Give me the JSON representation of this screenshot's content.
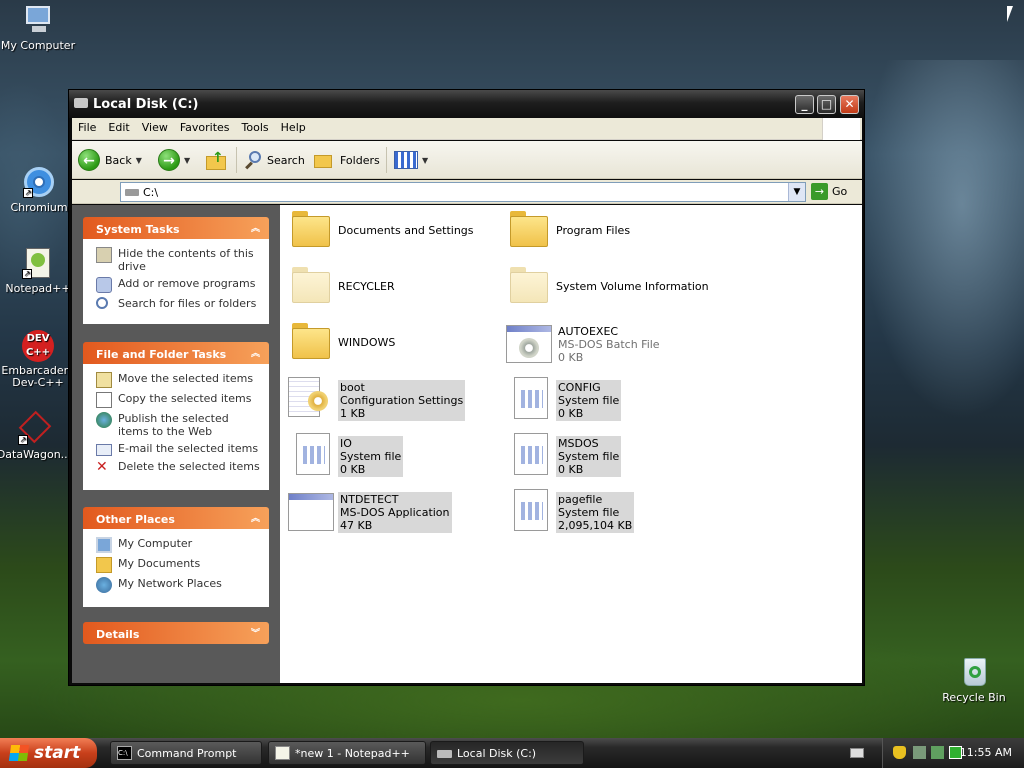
{
  "desktop": {
    "icons": [
      {
        "label": "My Computer"
      },
      {
        "label": "Chromium"
      },
      {
        "label": "Notepad++"
      },
      {
        "label": "Embarcadero Dev-C++"
      },
      {
        "label": "DataWagon..."
      },
      {
        "label": "Recycle Bin"
      }
    ]
  },
  "window": {
    "title": "Local Disk (C:)",
    "controls": {
      "minimize": "_",
      "maximize": "□",
      "close": "✕"
    }
  },
  "menu": [
    "File",
    "Edit",
    "View",
    "Favorites",
    "Tools",
    "Help"
  ],
  "toolbar": {
    "back_label": "Back",
    "search_label": "Search",
    "folders_label": "Folders"
  },
  "address": {
    "value": "C:\\",
    "go_label": "Go"
  },
  "taskpane": {
    "system_tasks": {
      "title": "System Tasks",
      "items": [
        "Hide the contents of this drive",
        "Add or remove programs",
        "Search for files or folders"
      ]
    },
    "file_folder_tasks": {
      "title": "File and Folder Tasks",
      "items": [
        "Move the selected items",
        "Copy the selected items",
        "Publish the selected items to the Web",
        "E-mail the selected items",
        "Delete the selected items"
      ]
    },
    "other_places": {
      "title": "Other Places",
      "items": [
        "My Computer",
        "My Documents",
        "My Network Places"
      ]
    },
    "details": {
      "title": "Details"
    }
  },
  "files": [
    {
      "name": "Documents and Settings",
      "type": "folder"
    },
    {
      "name": "Program Files",
      "type": "folder"
    },
    {
      "name": "RECYCLER",
      "type": "folder-hidden"
    },
    {
      "name": "System Volume Information",
      "type": "folder-hidden"
    },
    {
      "name": "WINDOWS",
      "type": "folder"
    },
    {
      "name": "AUTOEXEC",
      "desc": "MS-DOS Batch File",
      "size": "0 KB",
      "type": "batch"
    },
    {
      "name": "boot",
      "desc": "Configuration Settings",
      "size": "1 KB",
      "type": "config"
    },
    {
      "name": "CONFIG",
      "desc": "System file",
      "size": "0 KB",
      "type": "sys"
    },
    {
      "name": "IO",
      "desc": "System file",
      "size": "0 KB",
      "type": "sys"
    },
    {
      "name": "MSDOS",
      "desc": "System file",
      "size": "0 KB",
      "type": "sys"
    },
    {
      "name": "NTDETECT",
      "desc": "MS-DOS Application",
      "size": "47 KB",
      "type": "app"
    },
    {
      "name": "pagefile",
      "desc": "System file",
      "size": "2,095,104 KB",
      "type": "sys"
    }
  ],
  "taskbar": {
    "start_label": "start",
    "tasks": [
      {
        "label": "Command Prompt"
      },
      {
        "label": "*new 1 - Notepad++"
      },
      {
        "label": "Local Disk (C:)"
      }
    ],
    "clock": "11:55 AM"
  }
}
